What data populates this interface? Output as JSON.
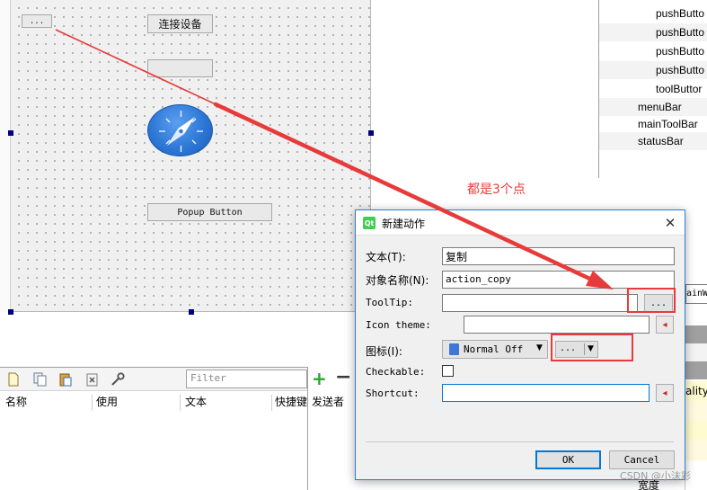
{
  "designer": {
    "canvas_buttons": {
      "dots_label": "...",
      "connect_label": "连接设备",
      "empty_label": "",
      "popup_label": "Popup Button"
    },
    "compass_icon": "compass-icon"
  },
  "object_tree": {
    "items": [
      {
        "label": "pushButto"
      },
      {
        "label": "pushButto"
      },
      {
        "label": "pushButto"
      },
      {
        "label": "pushButto"
      },
      {
        "label": "toolButtor"
      },
      {
        "label": "menuBar"
      },
      {
        "label": "mainToolBar"
      },
      {
        "label": "statusBar"
      }
    ]
  },
  "annotation": {
    "text": "都是3个点",
    "color": "#e83a3a"
  },
  "action_editor": {
    "filter_placeholder": "Filter",
    "columns": [
      "名称",
      "使用",
      "文本",
      "快捷键"
    ],
    "toolbar_icons": [
      "new-file-icon",
      "copy-icon",
      "paste-icon",
      "delete-icon",
      "wrench-icon"
    ]
  },
  "signal_panel": {
    "sender_header": "发送者",
    "plus": "+",
    "minus": "−"
  },
  "property_panel": {
    "cells": [
      "ainWi",
      "",
      "",
      "",
      "ality",
      "",
      "",
      ""
    ],
    "bottom_label": "宽度"
  },
  "dialog": {
    "title": "新建动作",
    "close": "✕",
    "fields": {
      "text_label": "文本(T):",
      "text_value": "复制",
      "object_name_label": "对象名称(N):",
      "object_name_value": "action_copy",
      "tooltip_label": "ToolTip:",
      "tooltip_value": "",
      "tooltip_dots": "...",
      "icon_theme_label": "Icon theme:",
      "icon_theme_value": "",
      "icon_label": "图标(I):",
      "icon_combo_value": "Normal Off",
      "icon_dots": "...",
      "checkable_label": "Checkable:",
      "shortcut_label": "Shortcut:",
      "shortcut_value": ""
    },
    "buttons": {
      "ok": "OK",
      "cancel": "Cancel"
    },
    "accent": "#0078d7"
  },
  "watermark": "CSDN @小沫彩"
}
